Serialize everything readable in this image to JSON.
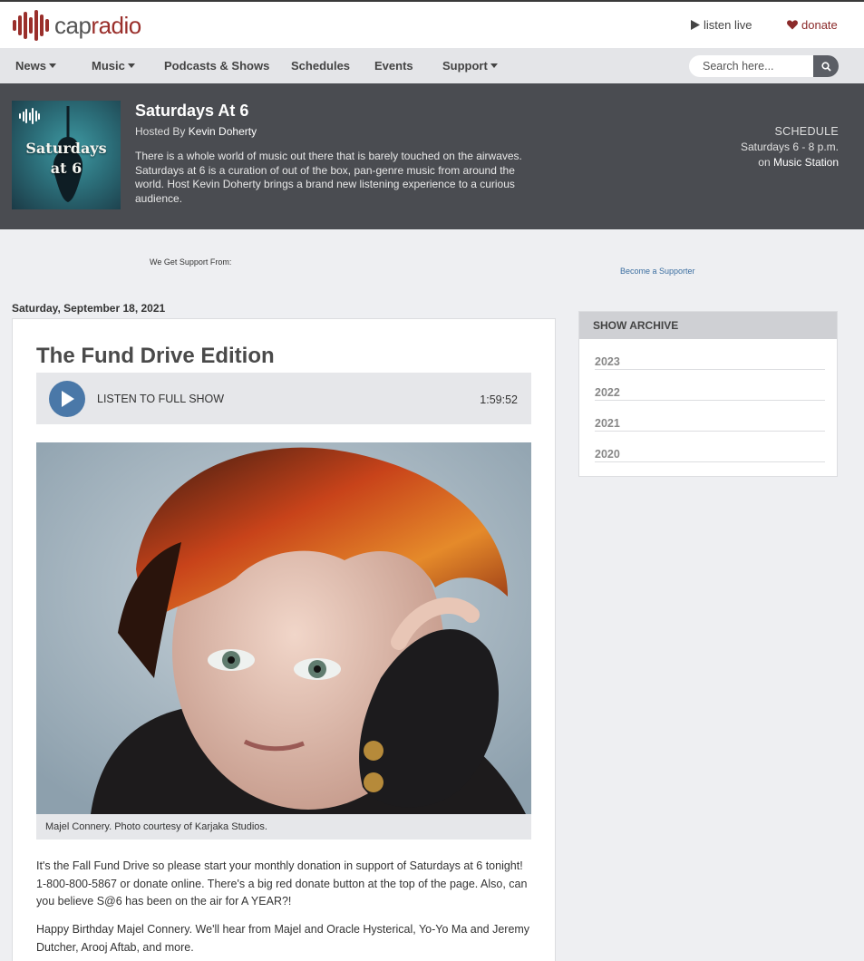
{
  "header": {
    "logo_part1": "cap",
    "logo_part2": "radio",
    "listen_live": "listen live",
    "donate": "donate"
  },
  "nav": {
    "items": [
      {
        "label": "News"
      },
      {
        "label": "Music"
      },
      {
        "label": "Podcasts & Shows"
      },
      {
        "label": "Schedules"
      },
      {
        "label": "Events"
      },
      {
        "label": "Support"
      }
    ],
    "search_placeholder": "Search here..."
  },
  "show": {
    "art_line1": "Saturdays",
    "art_line2": "at 6",
    "title": "Saturdays At 6",
    "hosted_by_label": "Hosted By",
    "host": "Kevin Doherty",
    "description": "There is a whole world of music out there that is barely touched on the airwaves. Saturdays at 6 is a curation of out of the box, pan-genre music from around the world. Host Kevin Doherty brings a brand new listening experience to a curious audience.",
    "schedule_label": "SCHEDULE",
    "schedule_time": "Saturdays 6 - 8 p.m.",
    "schedule_on": "on",
    "station": "Music Station"
  },
  "support": {
    "label": "We Get Support From:",
    "become": "Become a Supporter"
  },
  "episode": {
    "date": "Saturday, September 18, 2021",
    "title": "The Fund Drive Edition",
    "listen_label": "LISTEN TO FULL SHOW",
    "duration": "1:59:52",
    "caption": "Majel Connery. Photo courtesy of Karjaka Studios.",
    "paragraph1": "It's the Fall Fund Drive so please start your monthly donation in support of Saturdays at 6 tonight! 1-800-800-5867 or donate online. There's a big red donate button at the top of the page. Also, can you believe S@6 has been on the air for A YEAR?!",
    "paragraph2": "Happy Birthday Majel Connery. We'll hear from Majel and Oracle Hysterical, Yo-Yo Ma and Jeremy Dutcher, Arooj Aftab, and more."
  },
  "archive": {
    "title": "SHOW ARCHIVE",
    "years": [
      "2023",
      "2022",
      "2021",
      "2020"
    ]
  },
  "colors": {
    "brand_red": "#9a2f2b",
    "banner_bg": "#4a4c51",
    "play_blue": "#4a78a8"
  }
}
